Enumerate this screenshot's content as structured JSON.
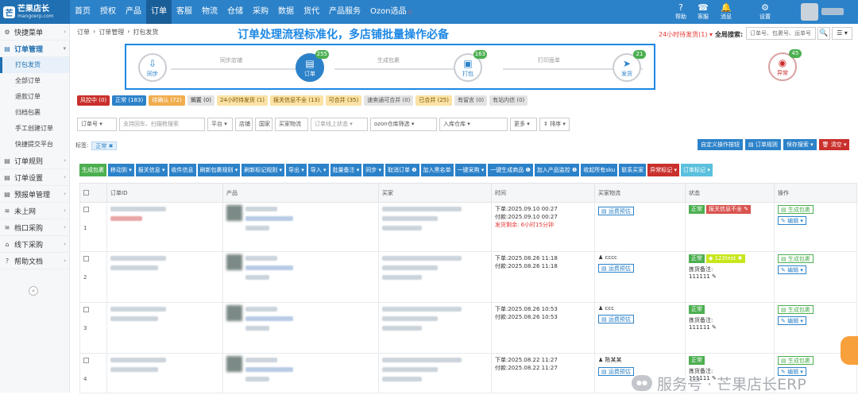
{
  "app": {
    "logo_title": "芒果店长",
    "logo_sub": "mangoerp.com",
    "logo_mark": "芒"
  },
  "topnav": [
    {
      "label": "首页",
      "active": false
    },
    {
      "label": "授权",
      "active": false
    },
    {
      "label": "产品",
      "active": false
    },
    {
      "label": "订单",
      "active": true
    },
    {
      "label": "客服",
      "active": false
    },
    {
      "label": "物流",
      "active": false
    },
    {
      "label": "仓储",
      "active": false
    },
    {
      "label": "采购",
      "active": false
    },
    {
      "label": "数据",
      "active": false
    },
    {
      "label": "货代",
      "active": false
    },
    {
      "label": "产品服务",
      "active": false
    },
    {
      "label": "Ozon选品",
      "active": false
    }
  ],
  "topicons": [
    {
      "label": "帮助",
      "icon": "help-icon",
      "glyph": "?"
    },
    {
      "label": "客服",
      "icon": "support-icon",
      "glyph": "☎"
    },
    {
      "label": "消息",
      "icon": "bell-icon",
      "glyph": "🔔"
    },
    {
      "label": "设置",
      "icon": "gear-icon",
      "glyph": "⚙"
    }
  ],
  "sidebar": {
    "groups": [
      {
        "label": "快捷菜单",
        "icon": "shortcut-icon",
        "glyph": "⚙",
        "open": false
      },
      {
        "label": "订单管理",
        "icon": "order-icon",
        "glyph": "▤",
        "open": true,
        "items": [
          {
            "label": "打包发货",
            "active": true
          },
          {
            "label": "全部订单",
            "active": false
          },
          {
            "label": "退款订单",
            "active": false
          },
          {
            "label": "归档包裹",
            "active": false
          },
          {
            "label": "手工创建订单",
            "active": false
          },
          {
            "label": "快捷提交平台",
            "active": false
          }
        ]
      },
      {
        "label": "订单规则",
        "icon": "rule-icon",
        "glyph": "▤",
        "open": false
      },
      {
        "label": "订单设置",
        "icon": "setting-icon",
        "glyph": "▤",
        "open": false
      },
      {
        "label": "预报单管理",
        "icon": "forecast-icon",
        "glyph": "▤",
        "open": false
      },
      {
        "label": "未上网",
        "icon": "wifi-icon",
        "glyph": "≋",
        "open": false
      },
      {
        "label": "档口采购",
        "icon": "wifi-icon",
        "glyph": "≋",
        "open": false
      },
      {
        "label": "线下采购",
        "icon": "cart-icon",
        "glyph": "⌂",
        "open": false
      },
      {
        "label": "帮助文档",
        "icon": "help-icon",
        "glyph": "?",
        "open": false
      }
    ],
    "collapse_glyph": "«"
  },
  "breadcrumb": [
    "订单",
    "›",
    "订单管理",
    "›",
    "打包发货"
  ],
  "banner": "订单处理流程标准化，多店铺批量操作必备",
  "pending_label": "24小时待发货(1) ▾",
  "global_search": {
    "label": "全局搜索:",
    "placeholder": "订单号、包裹号、运单号",
    "search_glyph": "🔍",
    "menu_glyph": "☰ ▾"
  },
  "flow": {
    "steps": [
      {
        "label": "同步",
        "glyph": "⇩",
        "count": ""
      },
      {
        "label": "订单",
        "glyph": "▤",
        "count": "255"
      },
      {
        "label": "打包",
        "glyph": "▣",
        "count": "163"
      },
      {
        "label": "发货",
        "glyph": "➤",
        "count": "21"
      }
    ],
    "connectors": [
      "同步店铺",
      "生成包裹",
      "打印面单"
    ],
    "exception": {
      "label": "异常",
      "glyph": "◉",
      "count": "45"
    }
  },
  "status_tabs": [
    {
      "label": "风控中 (0)",
      "bg": "#c9302c",
      "fg": "#ffffff"
    },
    {
      "label": "正常 (183)",
      "bg": "#2c82c9",
      "fg": "#ffffff"
    },
    {
      "label": "待确认 (72)",
      "bg": "#f0ad4e",
      "fg": "#ffffff"
    },
    {
      "label": "搁置 (0)",
      "bg": "#e4e4e4",
      "fg": "#333333"
    },
    {
      "label": "24小时待发货 (1)",
      "bg": "#fbe2a6",
      "fg": "#7a5500"
    },
    {
      "label": "报关信息不全 (13)",
      "bg": "#fbe2a6",
      "fg": "#7a5500"
    },
    {
      "label": "可合并 (35)",
      "bg": "#fbe2a6",
      "fg": "#7a5500"
    },
    {
      "label": "速卖通可合并 (0)",
      "bg": "#e4e4e4",
      "fg": "#555555"
    },
    {
      "label": "已合并 (25)",
      "bg": "#fbe2a6",
      "fg": "#7a5500"
    },
    {
      "label": "有留言 (0)",
      "bg": "#e4e4e4",
      "fg": "#555555"
    },
    {
      "label": "有站内信 (0)",
      "bg": "#e4e4e4",
      "fg": "#555555"
    }
  ],
  "filters": [
    {
      "label": "订单号 ▾",
      "placeholder": false
    },
    {
      "label": "支持回车、扫描枪搜索",
      "placeholder": true
    },
    {
      "label": "平台 ▾",
      "placeholder": false
    },
    {
      "label": "店铺",
      "placeholder": false
    },
    {
      "label": "国家",
      "placeholder": false
    },
    {
      "label": "买家物流",
      "placeholder": false
    },
    {
      "label": "订单线上状态 ▾",
      "placeholder": true
    },
    {
      "label": "ozon仓库筛选 ▾",
      "placeholder": false
    },
    {
      "label": "入库仓库 ▾",
      "placeholder": false
    },
    {
      "label": "更多 ▾",
      "placeholder": false
    },
    {
      "label": "⇕ 排序 ▾",
      "placeholder": false
    }
  ],
  "tag_filter": {
    "label": "标签:",
    "chip": "正常 ✖"
  },
  "right_buttons": [
    {
      "label": "自定义操作按钮",
      "bg": "#2c82c9"
    },
    {
      "label": "▤ 订单规则",
      "bg": "#2c82c9"
    },
    {
      "label": "保存搜索 ▾",
      "bg": "#2c82c9"
    },
    {
      "label": "🗑 清空 ▾",
      "bg": "#c9302c"
    }
  ],
  "action_buttons": [
    {
      "label": "生成包裹",
      "bg": "#4caf50"
    },
    {
      "label": "移动到 ▾",
      "bg": "#2c82c9"
    },
    {
      "label": "报关信息 ▾",
      "bg": "#2c82c9"
    },
    {
      "label": "收件信息",
      "bg": "#2c82c9"
    },
    {
      "label": "刷新包裹规则 ▾",
      "bg": "#2c82c9"
    },
    {
      "label": "刷新标记规则 ▾",
      "bg": "#2c82c9"
    },
    {
      "label": "导出 ▾",
      "bg": "#2c82c9"
    },
    {
      "label": "导入 ▾",
      "bg": "#2c82c9"
    },
    {
      "label": "批量备注 ▾",
      "bg": "#2c82c9"
    },
    {
      "label": "同步 ▾",
      "bg": "#2c82c9"
    },
    {
      "label": "取消订单 ❶",
      "bg": "#2c82c9"
    },
    {
      "label": "加入黑名单",
      "bg": "#2c82c9"
    },
    {
      "label": "一键采购 ▾",
      "bg": "#2c82c9"
    },
    {
      "label": "一键生成商品 ❶",
      "bg": "#2c82c9"
    },
    {
      "label": "加入产品监控 ❶",
      "bg": "#2c82c9"
    },
    {
      "label": "收起所有sku",
      "bg": "#2c82c9"
    },
    {
      "label": "联系买家",
      "bg": "#2c82c9"
    },
    {
      "label": "异常标记 ▾",
      "bg": "#c9302c"
    },
    {
      "label": "订单标记 ▾",
      "bg": "#5bc0de"
    }
  ],
  "table": {
    "headers": [
      "",
      "订单ID",
      "产品",
      "买家",
      "时间",
      "买家物流",
      "状态",
      "操作"
    ],
    "rows": [
      {
        "num": "1",
        "order_time": "下单:2025.09.10 00:27",
        "pay_time": "付款:2025.09.10 00:27",
        "ship_left": "发货剩余: 6小时15分钟",
        "buyer_name": "",
        "logistics": "▤ 运费预估",
        "status": "正常",
        "status_extra": "报关信息不全 ✎",
        "status_tag": "",
        "note_label": "",
        "note": "",
        "op1": "▤ 生成包裹",
        "op2": "✎ 编辑 ▾"
      },
      {
        "num": "2",
        "order_time": "下单:2025.08.26 11:18",
        "pay_time": "付款:2025.08.26 11:18",
        "ship_left": "",
        "buyer_name": "♟ cccc",
        "logistics": "▤ 运费预估",
        "status": "正常",
        "status_extra": "",
        "status_tag": "◆ 122test ✖",
        "note_label": "拣货备注:",
        "note": "111111 ✎",
        "op1": "▤ 生成包裹",
        "op2": "✎ 编辑 ▾"
      },
      {
        "num": "3",
        "order_time": "下单:2025.08.26 10:53",
        "pay_time": "付款:2025.08.26 10:53",
        "ship_left": "",
        "buyer_name": "♟ ccc",
        "logistics": "▤ 运费预估",
        "status": "正常",
        "status_extra": "",
        "status_tag": "",
        "note_label": "拣货备注:",
        "note": "111111 ✎",
        "op1": "▤ 生成包裹",
        "op2": "✎ 编辑 ▾"
      },
      {
        "num": "4",
        "order_time": "下单:2025.08.22 11:27",
        "pay_time": "付款:2025.08.22 11:27",
        "ship_left": "",
        "buyer_name": "♟ 陈某某",
        "logistics": "▤ 运费预估",
        "status": "正常",
        "status_extra": "",
        "status_tag": "",
        "note_label": "拣货备注:",
        "note": "111111 ✎",
        "op1": "▤ 生成包裹",
        "op2": "✎ 编辑 ▾"
      }
    ]
  },
  "watermark": {
    "text": "服务号 · 芒果店长ERP",
    "icon": "wechat-icon",
    "glyph": "●●"
  },
  "colors": {
    "primary": "#2c82c9",
    "topbar": "#2c82c9",
    "success": "#4caf50",
    "danger": "#c9302c",
    "warning": "#f0ad4e",
    "banner": "#1e88e5"
  }
}
